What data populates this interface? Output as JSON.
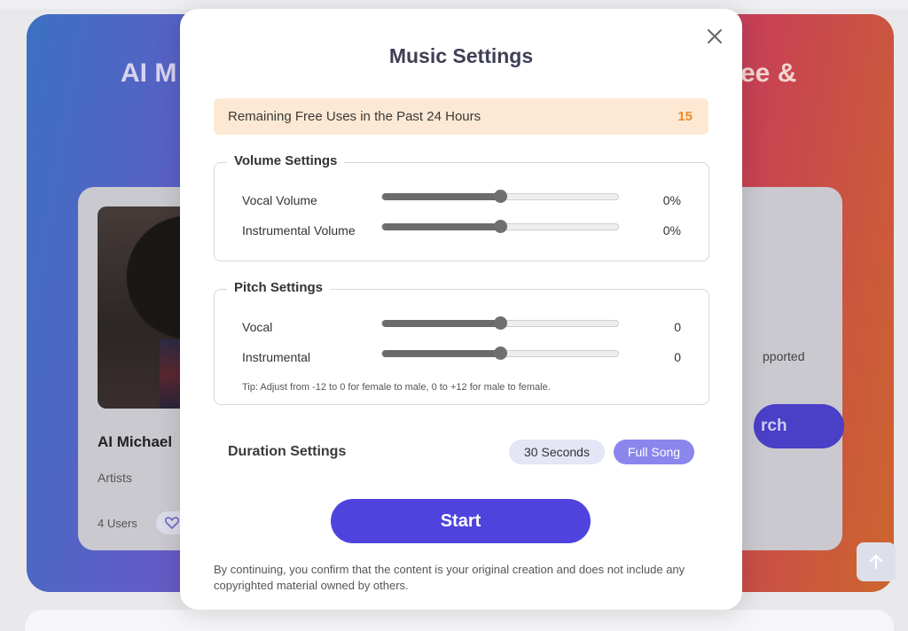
{
  "background": {
    "hero_title_left": "AI M",
    "hero_title_right": "ee &",
    "card_left": {
      "name": "AI Michael",
      "category": "Artists",
      "users": "4 Users"
    },
    "card_right": {
      "supported_text": "pported",
      "search_label": "rch"
    }
  },
  "modal": {
    "title": "Music Settings",
    "remaining": {
      "label": "Remaining Free Uses in the Past 24 Hours",
      "count": "15"
    },
    "volume_settings": {
      "legend": "Volume Settings",
      "rows": [
        {
          "label": "Vocal Volume",
          "value": "0%",
          "level": 0.5
        },
        {
          "label": "Instrumental Volume",
          "value": "0%",
          "level": 0.5
        }
      ]
    },
    "pitch_settings": {
      "legend": "Pitch Settings",
      "rows": [
        {
          "label": "Vocal",
          "value": "0",
          "level": 0.5
        },
        {
          "label": "Instrumental",
          "value": "0",
          "level": 0.5
        }
      ],
      "tip": "Tip: Adjust from -12 to 0 for female to male, 0 to +12 for male to female."
    },
    "duration": {
      "label": "Duration Settings",
      "options": [
        "30 Seconds",
        "Full Song"
      ],
      "selected": "Full Song"
    },
    "start_label": "Start",
    "disclaimer": "By continuing, you confirm that the content is your original creation and does not include any copyrighted material owned by others."
  },
  "colors": {
    "accent": "#4e44dd",
    "selected_pill": "#8a86ec",
    "remaining_bg": "#fde9d3",
    "remaining_count": "#f08a24"
  }
}
